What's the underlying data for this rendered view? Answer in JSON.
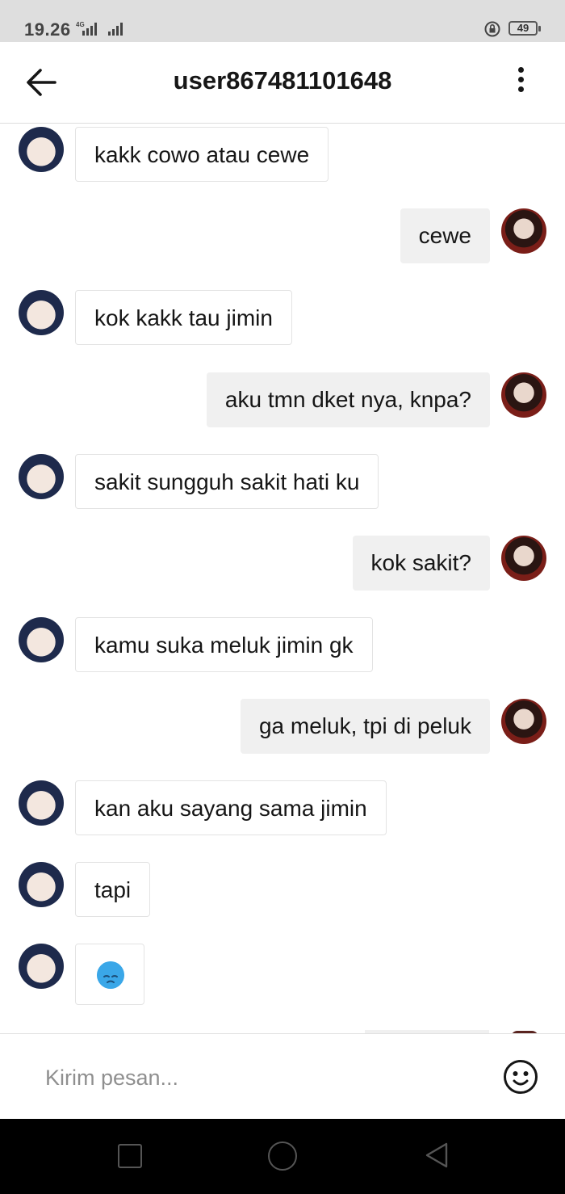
{
  "status_bar": {
    "time": "19.26",
    "network": "4G",
    "battery": "49"
  },
  "header": {
    "title": "user867481101648",
    "back_icon": "arrow-left-icon",
    "menu_icon": "more-vertical-icon"
  },
  "messages": [
    {
      "from": "them",
      "text": "kakk cowo atau cewe"
    },
    {
      "from": "me",
      "text": "cewe"
    },
    {
      "from": "them",
      "text": "kok kakk tau jimin"
    },
    {
      "from": "me",
      "text": "aku tmn dket nya, knpa?"
    },
    {
      "from": "them",
      "text": "sakit sungguh sakit hati ku"
    },
    {
      "from": "me",
      "text": "kok sakit?"
    },
    {
      "from": "them",
      "text": "kamu suka meluk jimin gk"
    },
    {
      "from": "me",
      "text": "ga meluk, tpi di peluk"
    },
    {
      "from": "them",
      "text": "kan aku sayang sama jimin"
    },
    {
      "from": "them",
      "text": "tapi"
    },
    {
      "from": "them",
      "emoji": "crying-face-emoji"
    }
  ],
  "composer": {
    "placeholder": "Kirim pesan...",
    "emoji_icon": "smiley-icon"
  },
  "nav_bar": {
    "icons": [
      "recent-apps-icon",
      "home-icon",
      "back-triangle-icon"
    ]
  }
}
